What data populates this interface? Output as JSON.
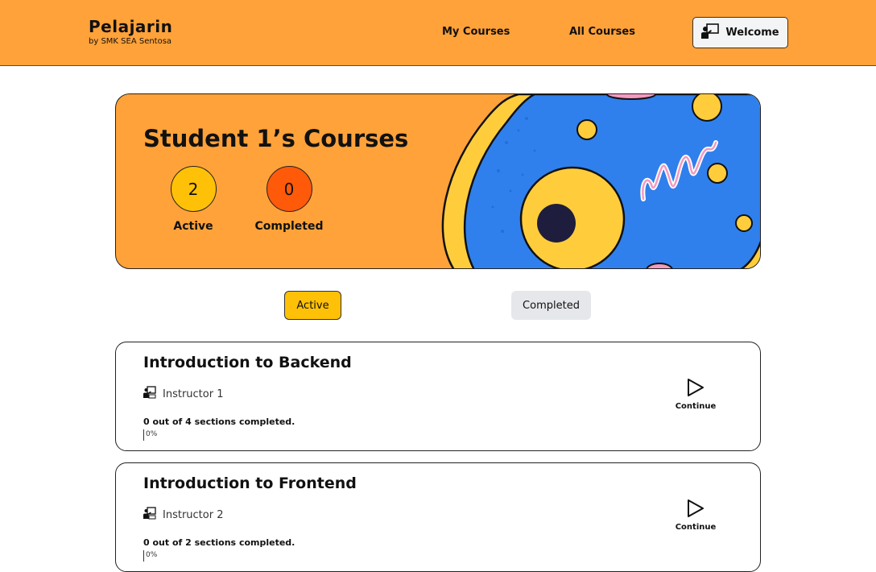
{
  "brand": {
    "title": "Pelajarin",
    "subtitle": "by SMK SEA Sentosa"
  },
  "nav": {
    "my_courses": "My Courses",
    "all_courses": "All Courses",
    "welcome": "Welcome"
  },
  "banner": {
    "title": "Student 1’s Courses",
    "active_count": "2",
    "active_label": "Active",
    "completed_count": "0",
    "completed_label": "Completed"
  },
  "tabs": {
    "active": "Active",
    "completed": "Completed"
  },
  "courses": [
    {
      "title": "Introduction to Backend",
      "instructor": "Instructor 1",
      "progress_text": "0 out of 4 sections completed.",
      "progress_pct": "0%",
      "progress_value": 0,
      "action": "Continue"
    },
    {
      "title": "Introduction to Frontend",
      "instructor": "Instructor 2",
      "progress_text": "0 out of 2 sections completed.",
      "progress_pct": "0%",
      "progress_value": 0,
      "action": "Continue"
    }
  ],
  "colors": {
    "accent": "#ffa23a",
    "active_yellow": "#ffc107",
    "completed_orange": "#ff5a0a",
    "cell_blue": "#2f80ed"
  }
}
